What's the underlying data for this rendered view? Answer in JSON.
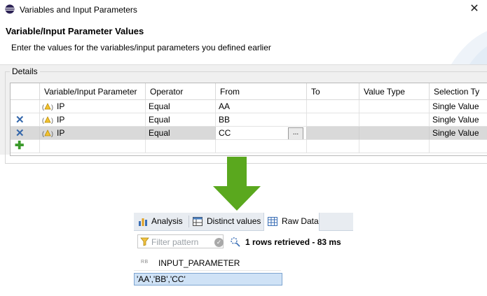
{
  "dialog": {
    "window_title": "Variables and Input Parameters",
    "close_symbol": "✕",
    "header_title": "Variable/Input Parameter Values",
    "header_description": "Enter the values for the variables/input parameters you defined earlier",
    "group_label": "Details",
    "columns": [
      "Variable/Input Parameter",
      "Operator",
      "From",
      "To",
      "Value Type",
      "Selection Ty"
    ],
    "rows": [
      {
        "name": "IP",
        "operator": "Equal",
        "from": "AA",
        "to": "",
        "value_type": "",
        "selection_type": "Single Value",
        "deletable": false,
        "selected": false
      },
      {
        "name": "IP",
        "operator": "Equal",
        "from": "BB",
        "to": "",
        "value_type": "",
        "selection_type": "Single Value",
        "deletable": true,
        "selected": false
      },
      {
        "name": "IP",
        "operator": "Equal",
        "from": "CC",
        "to": "",
        "value_type": "",
        "selection_type": "Single Value",
        "deletable": true,
        "selected": true
      }
    ],
    "ellipsis_label": "...",
    "delete_symbol": "✕",
    "add_symbol": "✚"
  },
  "arrow_color": "#5aa81e",
  "results": {
    "tabs": [
      {
        "label": "Analysis",
        "icon": "bar-chart-icon",
        "active": false
      },
      {
        "label": "Distinct values",
        "icon": "distinct-values-icon",
        "active": false
      },
      {
        "label": "Raw Data",
        "icon": "table-grid-icon",
        "active": true
      }
    ],
    "filter_placeholder": "Filter pattern",
    "status": "1 rows retrieved - 83 ms",
    "column_type_badge": "RB",
    "column_name": "INPUT_PARAMETER",
    "cell_value": "'AA','BB','CC'"
  }
}
